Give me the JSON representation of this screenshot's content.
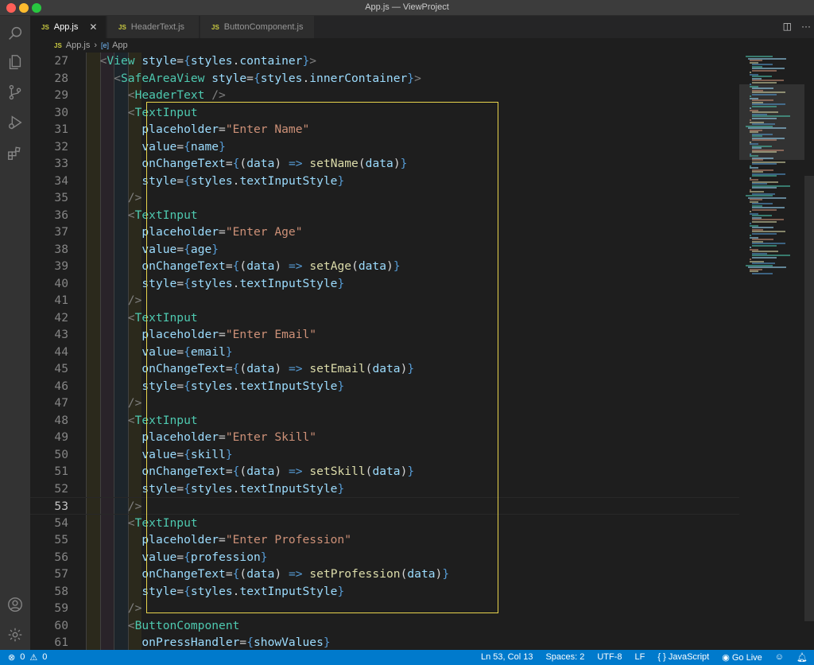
{
  "window": {
    "title": "App.js — ViewProject"
  },
  "tabs": [
    {
      "label": "App.js",
      "badge": "JS",
      "active": true
    },
    {
      "label": "HeaderText.js",
      "badge": "JS",
      "active": false
    },
    {
      "label": "ButtonComponent.js",
      "badge": "JS",
      "active": false
    }
  ],
  "breadcrumb": {
    "file": "App.js",
    "badge": "JS",
    "symbol_icon": "[e]",
    "symbol": "App"
  },
  "activity_icons": [
    "search-icon",
    "files-icon",
    "source-control-icon",
    "run-debug-icon",
    "extensions-icon",
    "account-icon",
    "settings-gear-icon"
  ],
  "editor": {
    "current_line": 53,
    "lines": [
      {
        "n": "27",
        "indent": 2,
        "tokens": [
          [
            "t-punc",
            "<"
          ],
          [
            "t-tag",
            "View"
          ],
          [
            "t-plain",
            " "
          ],
          [
            "t-attr",
            "style"
          ],
          [
            "t-op",
            "="
          ],
          [
            "t-brace",
            "{"
          ],
          [
            "t-var",
            "styles"
          ],
          [
            "t-plain",
            "."
          ],
          [
            "t-var",
            "container"
          ],
          [
            "t-brace",
            "}"
          ],
          [
            "t-punc",
            ">"
          ]
        ]
      },
      {
        "n": "28",
        "indent": 4,
        "tokens": [
          [
            "t-punc",
            "<"
          ],
          [
            "t-tag",
            "SafeAreaView"
          ],
          [
            "t-plain",
            " "
          ],
          [
            "t-attr",
            "style"
          ],
          [
            "t-op",
            "="
          ],
          [
            "t-brace",
            "{"
          ],
          [
            "t-var",
            "styles"
          ],
          [
            "t-plain",
            "."
          ],
          [
            "t-var",
            "innerContainer"
          ],
          [
            "t-brace",
            "}"
          ],
          [
            "t-punc",
            ">"
          ]
        ]
      },
      {
        "n": "29",
        "indent": 6,
        "tokens": [
          [
            "t-punc",
            "<"
          ],
          [
            "t-tag",
            "HeaderText"
          ],
          [
            "t-plain",
            " "
          ],
          [
            "t-punc",
            "/>"
          ]
        ]
      },
      {
        "n": "30",
        "indent": 6,
        "tokens": [
          [
            "t-punc",
            "<"
          ],
          [
            "t-tag",
            "TextInput"
          ]
        ]
      },
      {
        "n": "31",
        "indent": 8,
        "tokens": [
          [
            "t-attr",
            "placeholder"
          ],
          [
            "t-op",
            "="
          ],
          [
            "t-str",
            "\"Enter Name\""
          ]
        ]
      },
      {
        "n": "32",
        "indent": 8,
        "tokens": [
          [
            "t-attr",
            "value"
          ],
          [
            "t-op",
            "="
          ],
          [
            "t-brace",
            "{"
          ],
          [
            "t-var",
            "name"
          ],
          [
            "t-brace",
            "}"
          ]
        ]
      },
      {
        "n": "33",
        "indent": 8,
        "tokens": [
          [
            "t-attr",
            "onChangeText"
          ],
          [
            "t-op",
            "="
          ],
          [
            "t-brace",
            "{"
          ],
          [
            "t-plain",
            "("
          ],
          [
            "t-var",
            "data"
          ],
          [
            "t-plain",
            ")"
          ],
          [
            "t-plain",
            " "
          ],
          [
            "t-brace",
            "=>"
          ],
          [
            "t-plain",
            " "
          ],
          [
            "t-fn",
            "setName"
          ],
          [
            "t-plain",
            "("
          ],
          [
            "t-var",
            "data"
          ],
          [
            "t-plain",
            ")"
          ],
          [
            "t-brace",
            "}"
          ]
        ]
      },
      {
        "n": "34",
        "indent": 8,
        "tokens": [
          [
            "t-attr",
            "style"
          ],
          [
            "t-op",
            "="
          ],
          [
            "t-brace",
            "{"
          ],
          [
            "t-var",
            "styles"
          ],
          [
            "t-plain",
            "."
          ],
          [
            "t-var",
            "textInputStyle"
          ],
          [
            "t-brace",
            "}"
          ]
        ]
      },
      {
        "n": "35",
        "indent": 6,
        "tokens": [
          [
            "t-punc",
            "/>"
          ]
        ]
      },
      {
        "n": "36",
        "indent": 6,
        "tokens": [
          [
            "t-punc",
            "<"
          ],
          [
            "t-tag",
            "TextInput"
          ]
        ]
      },
      {
        "n": "37",
        "indent": 8,
        "tokens": [
          [
            "t-attr",
            "placeholder"
          ],
          [
            "t-op",
            "="
          ],
          [
            "t-str",
            "\"Enter Age\""
          ]
        ]
      },
      {
        "n": "38",
        "indent": 8,
        "tokens": [
          [
            "t-attr",
            "value"
          ],
          [
            "t-op",
            "="
          ],
          [
            "t-brace",
            "{"
          ],
          [
            "t-var",
            "age"
          ],
          [
            "t-brace",
            "}"
          ]
        ]
      },
      {
        "n": "39",
        "indent": 8,
        "tokens": [
          [
            "t-attr",
            "onChangeText"
          ],
          [
            "t-op",
            "="
          ],
          [
            "t-brace",
            "{"
          ],
          [
            "t-plain",
            "("
          ],
          [
            "t-var",
            "data"
          ],
          [
            "t-plain",
            ")"
          ],
          [
            "t-plain",
            " "
          ],
          [
            "t-brace",
            "=>"
          ],
          [
            "t-plain",
            " "
          ],
          [
            "t-fn",
            "setAge"
          ],
          [
            "t-plain",
            "("
          ],
          [
            "t-var",
            "data"
          ],
          [
            "t-plain",
            ")"
          ],
          [
            "t-brace",
            "}"
          ]
        ]
      },
      {
        "n": "40",
        "indent": 8,
        "tokens": [
          [
            "t-attr",
            "style"
          ],
          [
            "t-op",
            "="
          ],
          [
            "t-brace",
            "{"
          ],
          [
            "t-var",
            "styles"
          ],
          [
            "t-plain",
            "."
          ],
          [
            "t-var",
            "textInputStyle"
          ],
          [
            "t-brace",
            "}"
          ]
        ]
      },
      {
        "n": "41",
        "indent": 6,
        "tokens": [
          [
            "t-punc",
            "/>"
          ]
        ]
      },
      {
        "n": "42",
        "indent": 6,
        "tokens": [
          [
            "t-punc",
            "<"
          ],
          [
            "t-tag",
            "TextInput"
          ]
        ]
      },
      {
        "n": "43",
        "indent": 8,
        "tokens": [
          [
            "t-attr",
            "placeholder"
          ],
          [
            "t-op",
            "="
          ],
          [
            "t-str",
            "\"Enter Email\""
          ]
        ]
      },
      {
        "n": "44",
        "indent": 8,
        "tokens": [
          [
            "t-attr",
            "value"
          ],
          [
            "t-op",
            "="
          ],
          [
            "t-brace",
            "{"
          ],
          [
            "t-var",
            "email"
          ],
          [
            "t-brace",
            "}"
          ]
        ]
      },
      {
        "n": "45",
        "indent": 8,
        "tokens": [
          [
            "t-attr",
            "onChangeText"
          ],
          [
            "t-op",
            "="
          ],
          [
            "t-brace",
            "{"
          ],
          [
            "t-plain",
            "("
          ],
          [
            "t-var",
            "data"
          ],
          [
            "t-plain",
            ")"
          ],
          [
            "t-plain",
            " "
          ],
          [
            "t-brace",
            "=>"
          ],
          [
            "t-plain",
            " "
          ],
          [
            "t-fn",
            "setEmail"
          ],
          [
            "t-plain",
            "("
          ],
          [
            "t-var",
            "data"
          ],
          [
            "t-plain",
            ")"
          ],
          [
            "t-brace",
            "}"
          ]
        ]
      },
      {
        "n": "46",
        "indent": 8,
        "tokens": [
          [
            "t-attr",
            "style"
          ],
          [
            "t-op",
            "="
          ],
          [
            "t-brace",
            "{"
          ],
          [
            "t-var",
            "styles"
          ],
          [
            "t-plain",
            "."
          ],
          [
            "t-var",
            "textInputStyle"
          ],
          [
            "t-brace",
            "}"
          ]
        ]
      },
      {
        "n": "47",
        "indent": 6,
        "tokens": [
          [
            "t-punc",
            "/>"
          ]
        ]
      },
      {
        "n": "48",
        "indent": 6,
        "tokens": [
          [
            "t-punc",
            "<"
          ],
          [
            "t-tag",
            "TextInput"
          ]
        ]
      },
      {
        "n": "49",
        "indent": 8,
        "tokens": [
          [
            "t-attr",
            "placeholder"
          ],
          [
            "t-op",
            "="
          ],
          [
            "t-str",
            "\"Enter Skill\""
          ]
        ]
      },
      {
        "n": "50",
        "indent": 8,
        "tokens": [
          [
            "t-attr",
            "value"
          ],
          [
            "t-op",
            "="
          ],
          [
            "t-brace",
            "{"
          ],
          [
            "t-var",
            "skill"
          ],
          [
            "t-brace",
            "}"
          ]
        ]
      },
      {
        "n": "51",
        "indent": 8,
        "tokens": [
          [
            "t-attr",
            "onChangeText"
          ],
          [
            "t-op",
            "="
          ],
          [
            "t-brace",
            "{"
          ],
          [
            "t-plain",
            "("
          ],
          [
            "t-var",
            "data"
          ],
          [
            "t-plain",
            ")"
          ],
          [
            "t-plain",
            " "
          ],
          [
            "t-brace",
            "=>"
          ],
          [
            "t-plain",
            " "
          ],
          [
            "t-fn",
            "setSkill"
          ],
          [
            "t-plain",
            "("
          ],
          [
            "t-var",
            "data"
          ],
          [
            "t-plain",
            ")"
          ],
          [
            "t-brace",
            "}"
          ]
        ]
      },
      {
        "n": "52",
        "indent": 8,
        "tokens": [
          [
            "t-attr",
            "style"
          ],
          [
            "t-op",
            "="
          ],
          [
            "t-brace",
            "{"
          ],
          [
            "t-var",
            "styles"
          ],
          [
            "t-plain",
            "."
          ],
          [
            "t-var",
            "textInputStyle"
          ],
          [
            "t-brace",
            "}"
          ]
        ]
      },
      {
        "n": "53",
        "indent": 6,
        "tokens": [
          [
            "t-punc",
            "/>"
          ]
        ]
      },
      {
        "n": "54",
        "indent": 6,
        "tokens": [
          [
            "t-punc",
            "<"
          ],
          [
            "t-tag",
            "TextInput"
          ]
        ]
      },
      {
        "n": "55",
        "indent": 8,
        "tokens": [
          [
            "t-attr",
            "placeholder"
          ],
          [
            "t-op",
            "="
          ],
          [
            "t-str",
            "\"Enter Profession\""
          ]
        ]
      },
      {
        "n": "56",
        "indent": 8,
        "tokens": [
          [
            "t-attr",
            "value"
          ],
          [
            "t-op",
            "="
          ],
          [
            "t-brace",
            "{"
          ],
          [
            "t-var",
            "profession"
          ],
          [
            "t-brace",
            "}"
          ]
        ]
      },
      {
        "n": "57",
        "indent": 8,
        "tokens": [
          [
            "t-attr",
            "onChangeText"
          ],
          [
            "t-op",
            "="
          ],
          [
            "t-brace",
            "{"
          ],
          [
            "t-plain",
            "("
          ],
          [
            "t-var",
            "data"
          ],
          [
            "t-plain",
            ")"
          ],
          [
            "t-plain",
            " "
          ],
          [
            "t-brace",
            "=>"
          ],
          [
            "t-plain",
            " "
          ],
          [
            "t-fn",
            "setProfession"
          ],
          [
            "t-plain",
            "("
          ],
          [
            "t-var",
            "data"
          ],
          [
            "t-plain",
            ")"
          ],
          [
            "t-brace",
            "}"
          ]
        ]
      },
      {
        "n": "58",
        "indent": 8,
        "tokens": [
          [
            "t-attr",
            "style"
          ],
          [
            "t-op",
            "="
          ],
          [
            "t-brace",
            "{"
          ],
          [
            "t-var",
            "styles"
          ],
          [
            "t-plain",
            "."
          ],
          [
            "t-var",
            "textInputStyle"
          ],
          [
            "t-brace",
            "}"
          ]
        ]
      },
      {
        "n": "59",
        "indent": 6,
        "tokens": [
          [
            "t-punc",
            "/>"
          ]
        ]
      },
      {
        "n": "60",
        "indent": 6,
        "tokens": [
          [
            "t-punc",
            "<"
          ],
          [
            "t-tag",
            "ButtonComponent"
          ]
        ]
      },
      {
        "n": "61",
        "indent": 8,
        "tokens": [
          [
            "t-attr",
            "onPressHandler"
          ],
          [
            "t-op",
            "="
          ],
          [
            "t-brace",
            "{"
          ],
          [
            "t-var",
            "showValues"
          ],
          [
            "t-brace",
            "}"
          ]
        ]
      }
    ]
  },
  "status": {
    "errors": "0",
    "warnings": "0",
    "position": "Ln 53, Col 13",
    "spaces": "Spaces: 2",
    "encoding": "UTF-8",
    "eol": "LF",
    "language": "JavaScript",
    "language_icon": "{ }",
    "live": "Go Live"
  },
  "colors": {
    "highlight_box": "#e8d44d",
    "status_bar": "#007acc",
    "tag": "#4ec9b0",
    "attribute": "#9cdcfe",
    "string": "#ce9178",
    "function": "#dcdcaa"
  }
}
